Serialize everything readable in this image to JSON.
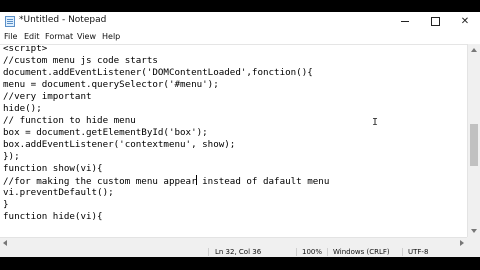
{
  "window": {
    "title": "*Untitled - Notepad"
  },
  "menubar": {
    "items": [
      "File",
      "Edit",
      "Format",
      "View",
      "Help"
    ]
  },
  "editor": {
    "lines": [
      "<script>",
      "//custom menu js code starts",
      "document.addEventListener('DOMContentLoaded',fonction(){",
      "menu = document.querySelector('#menu');",
      "//very important",
      "hide();",
      "// function to hide menu",
      "box = document.getElementById('box');",
      "box.addEventListener('contextmenu', show);",
      "});",
      "function show(vi){",
      "//for making the custom menu appear",
      "vi.preventDefault();",
      "}",
      "function hide(vi){"
    ],
    "caret_line_suffix": " instead of dafault menu"
  },
  "statusbar": {
    "position": "Ln 32, Col 36",
    "zoom": "100%",
    "line_endings": "Windows (CRLF)",
    "encoding": "UTF-8"
  }
}
